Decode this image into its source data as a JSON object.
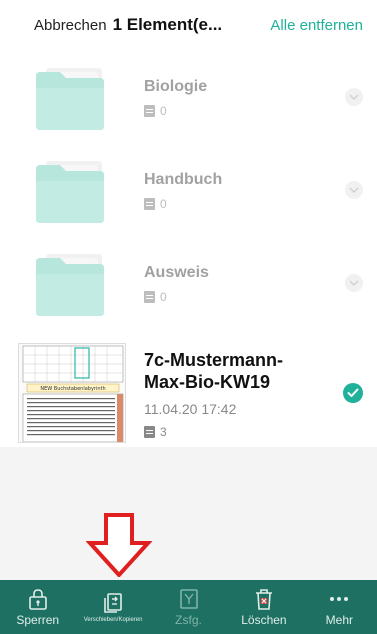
{
  "header": {
    "cancel_label": "Abbrechen",
    "title": "1 Element(e...",
    "remove_all_label": "Alle entfernen"
  },
  "folders": [
    {
      "name": "Biologie",
      "count": "0"
    },
    {
      "name": "Handbuch",
      "count": "0"
    },
    {
      "name": "Ausweis",
      "count": "0"
    }
  ],
  "document": {
    "title_line1": "7c-Mustermann-",
    "title_line2": "Max-Bio-KW19",
    "date": "11.04.20 17:42",
    "pages": "3",
    "selected": true,
    "thumb_caption": "NEW Buchstabenlabyrinth"
  },
  "toolbar": {
    "lock_label": "Sperren",
    "move_copy_label": "Verschieben/Kopieren",
    "merge_label": "Zsfg.",
    "delete_label": "Löschen",
    "more_label": "Mehr"
  },
  "colors": {
    "accent": "#1fb19a",
    "toolbar_bg": "#1e7062",
    "folder": "#7dd3c2",
    "arrow": "#e02020"
  },
  "icons": [
    "lock-icon",
    "move-copy-icon",
    "merge-icon",
    "delete-icon",
    "more-icon",
    "folder-icon",
    "chevron-down-icon",
    "check-icon",
    "page-icon",
    "down-arrow-icon"
  ]
}
